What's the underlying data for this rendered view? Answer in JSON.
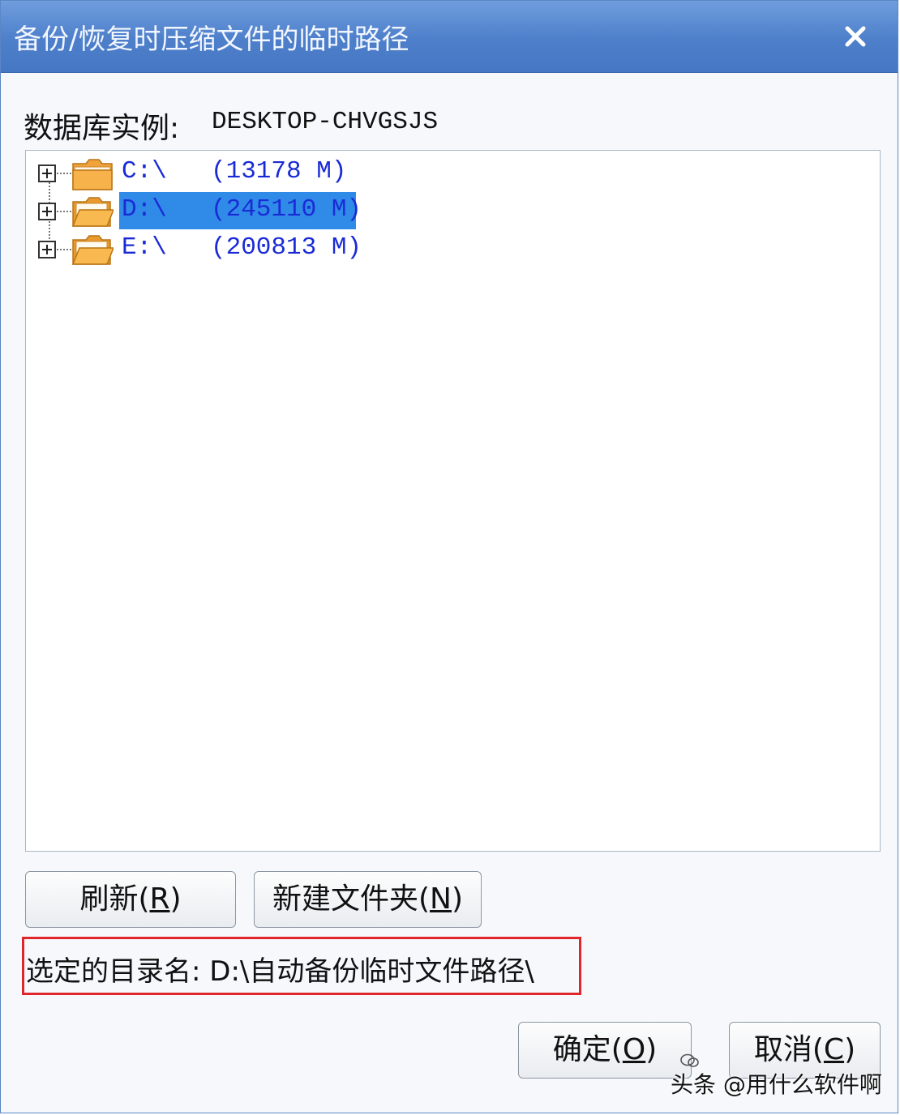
{
  "window": {
    "title": "备份/恢复时压缩文件的临时路径"
  },
  "database": {
    "label": "数据库实例:",
    "value": "DESKTOP-CHVGSJS"
  },
  "tree": {
    "items": [
      {
        "name": "C:\\",
        "size": "(13178 M)",
        "selected": false,
        "icon": "folder-closed-icon"
      },
      {
        "name": "D:\\",
        "size": "(245110 M)",
        "selected": true,
        "icon": "folder-open-icon"
      },
      {
        "name": "E:\\",
        "size": "(200813 M)",
        "selected": false,
        "icon": "folder-open-icon"
      }
    ]
  },
  "buttons": {
    "refresh": {
      "text": "刷新(",
      "key": "R",
      "end": ")"
    },
    "new_folder": {
      "text": "新建文件夹(",
      "key": "N",
      "end": ")"
    },
    "ok": {
      "text": "确定(",
      "key": "O",
      "end": ")"
    },
    "cancel": {
      "text": "取消(",
      "key": "C",
      "end": ")"
    }
  },
  "selected_dir": {
    "text": "选定的目录名: D:\\自动备份临时文件路径\\"
  },
  "watermark": {
    "text": "头条 @用什么软件啊"
  },
  "colors": {
    "title_bar": "#4d7fca",
    "selection": "#2f8ae8",
    "tree_text": "#1a2bd6",
    "highlight_box": "#e0262a"
  }
}
